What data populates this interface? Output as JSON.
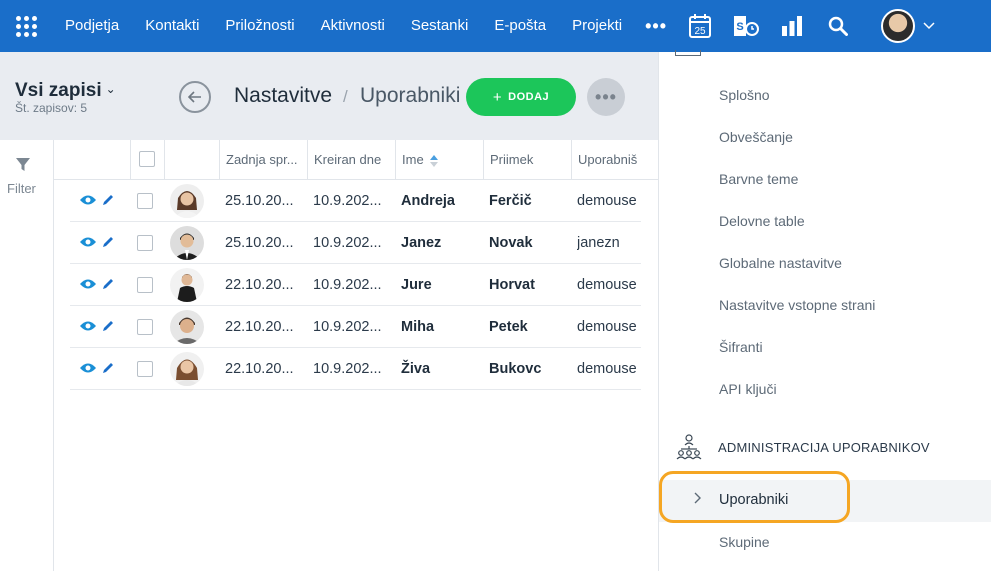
{
  "nav": {
    "items": [
      "Podjetja",
      "Kontakti",
      "Priložnosti",
      "Aktivnosti",
      "Sestanki",
      "E-pošta",
      "Projekti"
    ],
    "more": "•••",
    "calendar_day": "25"
  },
  "header": {
    "view_title": "Vsi zapisi",
    "record_count": "Št. zapisov: 5",
    "breadcrumb_title": "Nastavitve",
    "breadcrumb_sep": "/",
    "breadcrumb_current": "Uporabniki",
    "add_label": "DODAJ",
    "add_plus": "+",
    "more": "•••"
  },
  "filter": {
    "label": "Filter"
  },
  "table": {
    "columns": [
      "Zadnja spr...",
      "Kreiran dne",
      "Ime",
      "Priimek",
      "Uporabniš"
    ],
    "rows": [
      {
        "last_changed": "25.10.20...",
        "created": "10.9.202...",
        "first": "Andreja",
        "last": "Ferčič",
        "user": "demouse"
      },
      {
        "last_changed": "25.10.20...",
        "created": "10.9.202...",
        "first": "Janez",
        "last": "Novak",
        "user": "janezn"
      },
      {
        "last_changed": "22.10.20...",
        "created": "10.9.202...",
        "first": "Jure",
        "last": "Horvat",
        "user": "demouse"
      },
      {
        "last_changed": "22.10.20...",
        "created": "10.9.202...",
        "first": "Miha",
        "last": "Petek",
        "user": "demouse"
      },
      {
        "last_changed": "22.10.20...",
        "created": "10.9.202...",
        "first": "Živa",
        "last": "Bukovc",
        "user": "demouse"
      }
    ]
  },
  "settings": {
    "items": [
      "Splošno",
      "Obveščanje",
      "Barvne teme",
      "Delovne table",
      "Globalne nastavitve",
      "Nastavitve vstopne strani",
      "Šifranti",
      "API ključi"
    ],
    "section_title": "ADMINISTRACIJA UPORABNIKOV",
    "active_item": "Uporabniki",
    "after_item": "Skupine"
  },
  "colors": {
    "nav_bg": "#1a6ec9",
    "add_button": "#1cc65a",
    "highlight": "#f5a623",
    "icon_accent": "#1a8fd6"
  }
}
